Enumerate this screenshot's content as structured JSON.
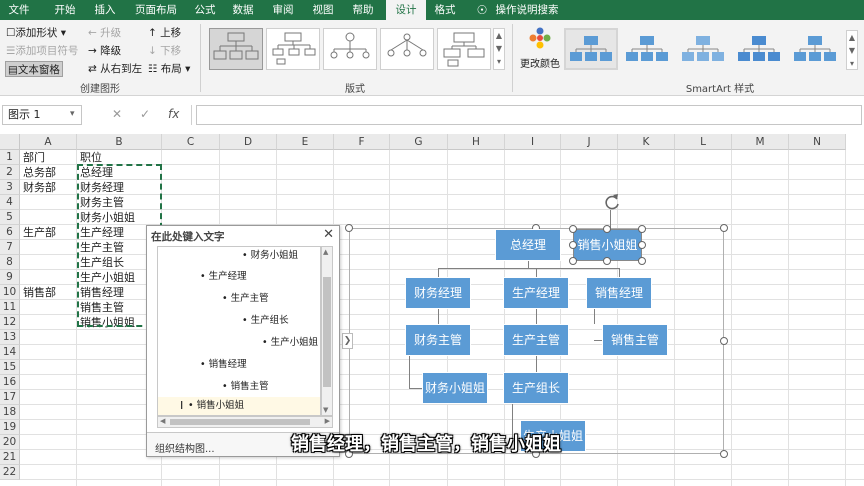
{
  "tabs": [
    "文件",
    "开始",
    "插入",
    "页面布局",
    "公式",
    "数据",
    "审阅",
    "视图",
    "帮助",
    "设计",
    "格式",
    "操作说明搜索"
  ],
  "active_tab": "设计",
  "ribbon": {
    "create": {
      "add_shape": "添加形状",
      "add_bullet": "添加项目符号",
      "text_pane": "文本窗格",
      "promote": "升级",
      "demote": "降级",
      "right_to_left": "从右到左",
      "move_up": "上移",
      "move_down": "下移",
      "layout": "布局",
      "group_label": "创建图形"
    },
    "layouts_label": "版式",
    "change_colors": "更改颜色",
    "styles_label": "SmartArt 样式"
  },
  "formula_bar": {
    "name_box": "图示 1",
    "value": ""
  },
  "columns": [
    "A",
    "B",
    "C",
    "D",
    "E",
    "F",
    "G",
    "H",
    "I",
    "J",
    "K",
    "L",
    "M",
    "N"
  ],
  "rows": [
    "1",
    "2",
    "3",
    "4",
    "5",
    "6",
    "7",
    "8",
    "9",
    "10",
    "11",
    "12",
    "13",
    "14",
    "15",
    "16",
    "17",
    "18",
    "19",
    "20",
    "21",
    "22"
  ],
  "cells": {
    "colA": [
      "部门",
      "总务部",
      "财务部",
      "",
      "",
      "生产部",
      "",
      "",
      "",
      "销售部",
      "",
      ""
    ],
    "colB": [
      "职位",
      "总经理",
      "财务经理",
      "财务主管",
      "财务小姐姐",
      "生产经理",
      "生产主管",
      "生产组长",
      "生产小姐姐",
      "销售经理",
      "销售主管",
      "销售小姐姐"
    ]
  },
  "text_pane": {
    "title": "在此处键入文字",
    "items": [
      {
        "text": "财务小姐姐",
        "level": 4
      },
      {
        "text": "生产经理",
        "level": 2
      },
      {
        "text": "生产主管",
        "level": 3
      },
      {
        "text": "生产组长",
        "level": 4
      },
      {
        "text": "生产小姐姐",
        "level": 5
      },
      {
        "text": "销售经理",
        "level": 2
      },
      {
        "text": "销售主管",
        "level": 3
      },
      {
        "text": "销售小姐姐",
        "level": 2
      }
    ],
    "footer": "组织结构图..."
  },
  "smartart": {
    "nodes": [
      "总经理",
      "销售小姐姐",
      "财务经理",
      "生产经理",
      "销售经理",
      "财务主管",
      "生产主管",
      "销售主管",
      "财务小姐姐",
      "生产组长",
      "生产小姐姐"
    ]
  },
  "subtitle": "销售经理，销售主管，销售小姐姐",
  "colors": {
    "accent": "#217346",
    "node": "#5b9bd5"
  }
}
